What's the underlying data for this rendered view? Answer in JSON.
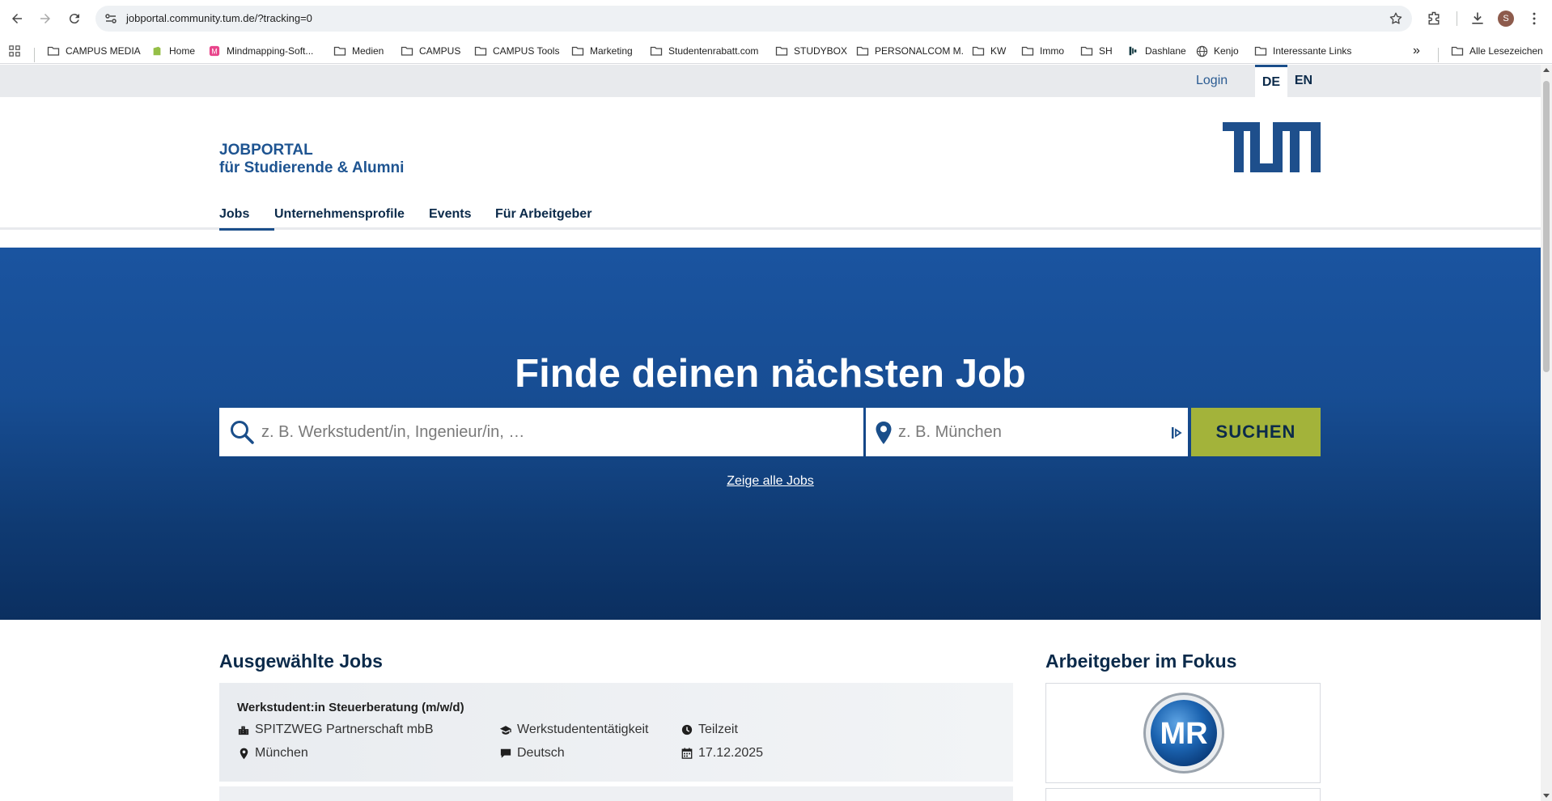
{
  "browser": {
    "url": "jobportal.community.tum.de/?tracking=0",
    "avatar_letter": "S",
    "bookmarks": [
      {
        "label": "CAMPUS MEDIA",
        "icon": "folder-icon"
      },
      {
        "label": "Home",
        "icon": "shopify-icon"
      },
      {
        "label": "Mindmapping-Soft...",
        "icon": "miro-icon"
      },
      {
        "label": "Medien",
        "icon": "folder-icon"
      },
      {
        "label": "CAMPUS",
        "icon": "folder-icon"
      },
      {
        "label": "CAMPUS Tools",
        "icon": "folder-icon"
      },
      {
        "label": "Marketing",
        "icon": "folder-icon"
      },
      {
        "label": "Studentenrabatt.com",
        "icon": "folder-icon"
      },
      {
        "label": "STUDYBOX",
        "icon": "folder-icon"
      },
      {
        "label": "PERSONALCOM M.",
        "icon": "folder-icon"
      },
      {
        "label": "KW",
        "icon": "folder-icon"
      },
      {
        "label": "Immo",
        "icon": "folder-icon"
      },
      {
        "label": "SH",
        "icon": "folder-icon"
      },
      {
        "label": "Dashlane",
        "icon": "dashlane-icon"
      },
      {
        "label": "Kenjo",
        "icon": "globe-icon"
      },
      {
        "label": "Interessante Links",
        "icon": "folder-icon"
      }
    ],
    "overflow_label": "»",
    "all_bookmarks": "Alle Lesezeichen"
  },
  "util": {
    "login": "Login",
    "lang_de": "DE",
    "lang_en": "EN"
  },
  "brand": {
    "title": "JOBPORTAL",
    "subtitle": "für Studierende & Alumni"
  },
  "nav": {
    "jobs": "Jobs",
    "companies": "Unternehmensprofile",
    "events": "Events",
    "employers": "Für Arbeitgeber"
  },
  "hero": {
    "title": "Finde deinen nächsten Job",
    "search_placeholder": "z. B. Werkstudent/in, Ingenieur/in, …",
    "location_placeholder": "z. B. München",
    "search_button": "SUCHEN",
    "show_all": "Zeige alle Jobs"
  },
  "featured": {
    "title": "Ausgewählte Jobs",
    "job": {
      "title": "Werkstudent:in Steuerberatung (m/w/d)",
      "company": "SPITZWEG Partnerschaft mbB",
      "location": "München",
      "type": "Werkstudententätigkeit",
      "language": "Deutsch",
      "hours": "Teilzeit",
      "date": "17.12.2025"
    }
  },
  "focus": {
    "title": "Arbeitgeber im Fokus",
    "logo_text": "MR"
  },
  "colors": {
    "primary": "#1a4e8a",
    "accent": "#a3b33a",
    "dark": "#0b2a4a"
  }
}
